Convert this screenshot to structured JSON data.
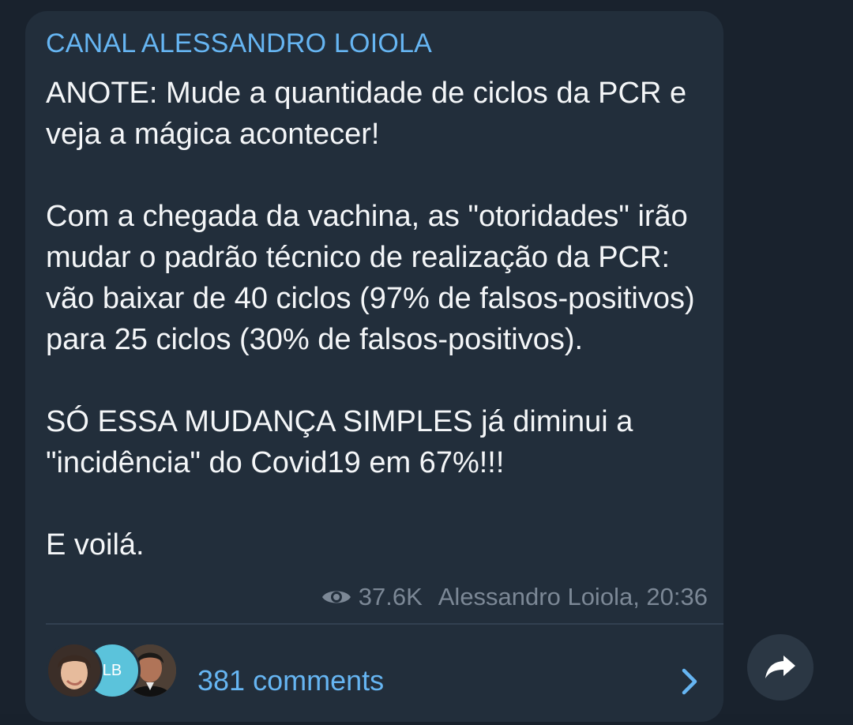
{
  "channel": {
    "name": "CANAL ALESSANDRO LOIOLA"
  },
  "message": {
    "paragraphs": [
      "ANOTE: Mude a quantidade de ciclos da PCR e veja a mágica acontecer!",
      "Com a chegada da vachina, as \"otoridades\" irão mudar o padrão técnico de realização da PCR: vão baixar de 40 ciclos (97% de falsos-positivos) para 25 ciclos (30% de falsos-positivos).",
      "SÓ ESSA MUDANÇA SIMPLES já diminui a \"incidência\" do Covid19 em 67%!!!",
      "E voilá."
    ],
    "views": "37.6K",
    "author_time": "Alessandro Loiola, 20:36"
  },
  "comments": {
    "label": "381 comments",
    "avatars": [
      {
        "name": "avatar-woman",
        "initials": ""
      },
      {
        "name": "avatar-initials",
        "initials": "LB"
      },
      {
        "name": "avatar-man",
        "initials": ""
      }
    ]
  },
  "icons": {
    "views": "eye-icon",
    "open_comments": "chevron-right-icon",
    "share": "share-arrow-icon"
  },
  "colors": {
    "background": "#19222d",
    "bubble": "#222e3b",
    "accent": "#66b5f2",
    "text": "#f4f6f8",
    "meta": "#7c8896"
  }
}
